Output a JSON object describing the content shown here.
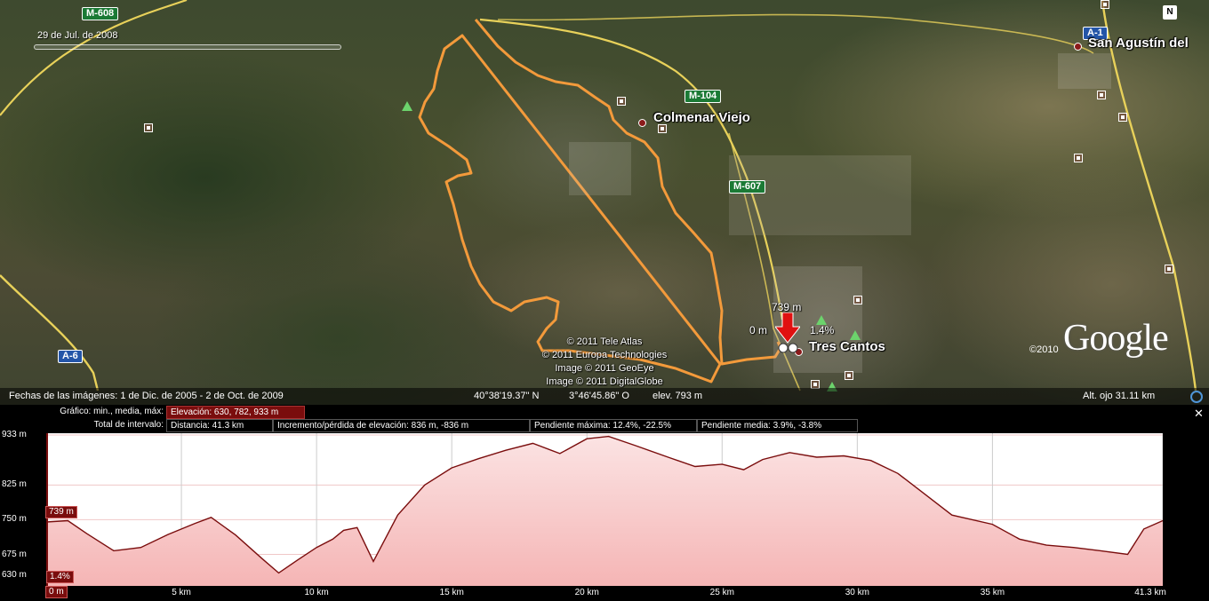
{
  "map": {
    "timeline_date": "29 de Jul. de 2008",
    "roads": {
      "m608": "M-608",
      "m104": "M-104",
      "m607": "M-607",
      "a6": "A-6",
      "a1": "A-1"
    },
    "places": {
      "colmenar": "Colmenar Viejo",
      "tres_cantos": "Tres Cantos",
      "san_agustin": "San Agustín del"
    },
    "marker": {
      "elevation": "739 m",
      "distance": "0 m",
      "slope": "1.4%"
    },
    "copyright": [
      "© 2011 Tele Atlas",
      "© 2011 Europa Technologies",
      "Image © 2011 GeoEye",
      "Image © 2011 DigitalGlobe"
    ],
    "google_year": "©2010",
    "google_logo": "Google",
    "compass": "N",
    "colors": {
      "route": "#f39a3b",
      "road": "#e8d15a"
    }
  },
  "status": {
    "imagery_dates": "Fechas de las imágenes:  1 de Dic. de 2005 -  2 de Oct. de 2009",
    "lat": "40°38'19.37\" N",
    "lon": "3°46'45.86\" O",
    "elev": "elev.  793 m",
    "eye_alt": "Alt. ojo    31.11 km"
  },
  "profile": {
    "graph_label": "Gráfico: min., media, máx:",
    "graph_value": "Elevación: 630, 782, 933 m",
    "range_label": "Total de intervalo:",
    "distance": "Distancia: 41.3 km",
    "gain_loss": "Incremento/pérdida de elevación: 836 m, -836 m",
    "max_slope": "Pendiente máxima: 12.4%, -22.5%",
    "avg_slope": "Pendiente media: 3.9%, -3.8%",
    "cursor_elev": "739 m",
    "cursor_slope": "1.4%",
    "cursor_dist": "0 m",
    "colors": {
      "line": "#7a0d0d",
      "fill": "#f5b5b5"
    }
  },
  "chart_data": {
    "type": "area",
    "xlabel": "",
    "ylabel": "",
    "xlim": [
      0,
      41.3
    ],
    "ylim": [
      630,
      933
    ],
    "x_ticks": [
      "5 km",
      "10 km",
      "15 km",
      "20 km",
      "25 km",
      "30 km",
      "35 km",
      "41.3 km"
    ],
    "y_ticks": [
      "933 m",
      "825 m",
      "750 m",
      "675 m",
      "630 m"
    ],
    "y_tick_values": [
      933,
      825,
      750,
      675,
      630
    ],
    "x_tick_values": [
      5,
      10,
      15,
      20,
      25,
      30,
      35,
      41.3
    ],
    "series": [
      {
        "x": [
          0,
          0.8,
          1.5,
          2.5,
          3.5,
          4.5,
          5.5,
          6.1,
          7,
          8,
          8.6,
          9.3,
          10,
          10.6,
          11,
          11.5,
          12.1,
          13,
          14,
          15,
          16,
          17,
          18,
          19,
          20,
          20.8,
          21.8,
          23,
          24,
          25,
          25.8,
          26.5,
          27.5,
          28.5,
          29.5,
          30.5,
          31.5,
          32.5,
          33.5,
          35,
          36,
          37,
          38,
          39,
          40,
          40.6,
          41.3
        ],
        "y": [
          745,
          748,
          720,
          683,
          690,
          718,
          742,
          755,
          717,
          665,
          635,
          663,
          690,
          708,
          727,
          733,
          660,
          760,
          825,
          862,
          882,
          900,
          915,
          893,
          925,
          930,
          910,
          885,
          865,
          870,
          858,
          880,
          895,
          885,
          888,
          878,
          850,
          805,
          760,
          740,
          708,
          695,
          690,
          683,
          675,
          730,
          748
        ]
      }
    ]
  }
}
